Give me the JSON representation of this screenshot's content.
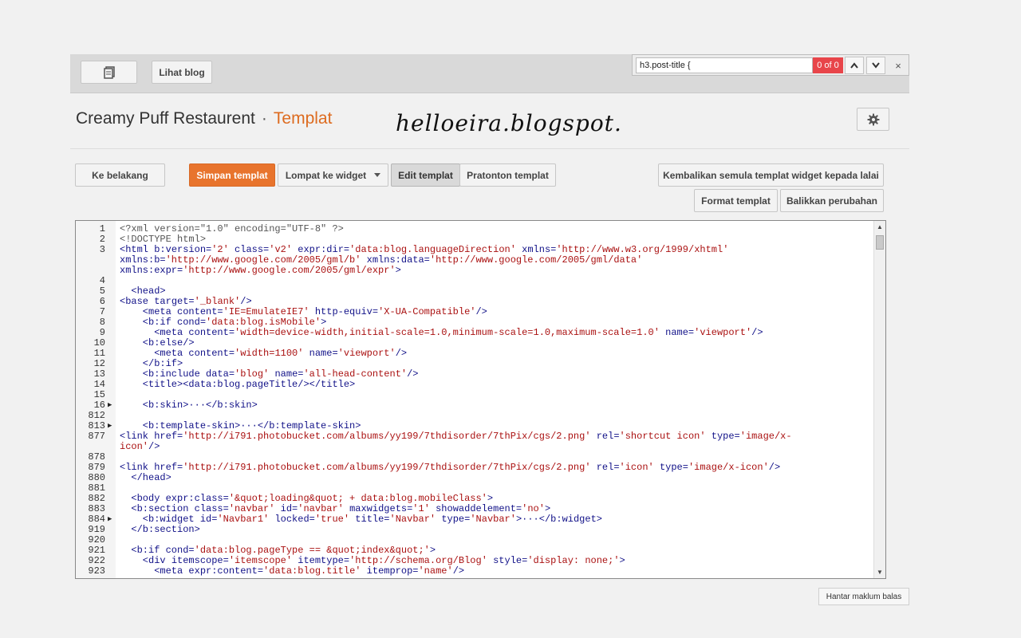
{
  "topbar": {
    "lihat_blog_label": "Lihat blog"
  },
  "find": {
    "value": "h3.post-title {",
    "count": "0 of 0",
    "close": "×"
  },
  "header": {
    "blog_name": "Creamy Puff Restaurent",
    "separator": "·",
    "section": "Templat",
    "watermark": "helloeira.blogspot."
  },
  "toolbar": {
    "ke_belakang": "Ke belakang",
    "simpan": "Simpan templat",
    "lompat": "Lompat ke widget",
    "edit": "Edit templat",
    "pratonton": "Pratonton templat",
    "kembalikan": "Kembalikan semula templat widget kepada lalai",
    "format": "Format templat",
    "balikkan": "Balikkan perubahan"
  },
  "editor": {
    "lines": [
      {
        "n": "1",
        "f": "",
        "c": [
          [
            "p",
            "<?xml version=\"1.0\" encoding=\"UTF-8\" ?>"
          ]
        ]
      },
      {
        "n": "2",
        "f": "",
        "c": [
          [
            "p",
            "<!DOCTYPE html>"
          ]
        ]
      },
      {
        "n": "3",
        "f": "",
        "c": [
          [
            "t",
            "<html "
          ],
          [
            "a",
            "b:version="
          ],
          [
            "v",
            "'2' "
          ],
          [
            "a",
            "class="
          ],
          [
            "v",
            "'v2' "
          ],
          [
            "a",
            "expr:dir="
          ],
          [
            "v",
            "'data:blog.languageDirection' "
          ],
          [
            "a",
            "xmlns="
          ],
          [
            "v",
            "'http://www.w3.org/1999/xhtml'"
          ]
        ]
      },
      {
        "n": "",
        "f": "",
        "c": [
          [
            "a",
            "xmlns:b="
          ],
          [
            "v",
            "'http://www.google.com/2005/gml/b' "
          ],
          [
            "a",
            "xmlns:data="
          ],
          [
            "v",
            "'http://www.google.com/2005/gml/data'"
          ]
        ]
      },
      {
        "n": "",
        "f": "",
        "c": [
          [
            "a",
            "xmlns:expr="
          ],
          [
            "v",
            "'http://www.google.com/2005/gml/expr'"
          ],
          [
            "t",
            ">"
          ]
        ]
      },
      {
        "n": "4",
        "f": "",
        "c": [
          [
            "p",
            ""
          ]
        ]
      },
      {
        "n": "5",
        "f": "",
        "c": [
          [
            "t",
            "  <head>"
          ]
        ]
      },
      {
        "n": "6",
        "f": "",
        "c": [
          [
            "t",
            "<base "
          ],
          [
            "a",
            "target="
          ],
          [
            "v",
            "'_blank'"
          ],
          [
            "t",
            "/>"
          ]
        ]
      },
      {
        "n": "7",
        "f": "",
        "c": [
          [
            "t",
            "    <meta "
          ],
          [
            "a",
            "content="
          ],
          [
            "v",
            "'IE=EmulateIE7' "
          ],
          [
            "a",
            "http-equiv="
          ],
          [
            "v",
            "'X-UA-Compatible'"
          ],
          [
            "t",
            "/>"
          ]
        ]
      },
      {
        "n": "8",
        "f": "",
        "c": [
          [
            "t",
            "    <b:if "
          ],
          [
            "a",
            "cond="
          ],
          [
            "v",
            "'data:blog.isMobile'"
          ],
          [
            "t",
            ">"
          ]
        ]
      },
      {
        "n": "9",
        "f": "",
        "c": [
          [
            "t",
            "      <meta "
          ],
          [
            "a",
            "content="
          ],
          [
            "v",
            "'width=device-width,initial-scale=1.0,minimum-scale=1.0,maximum-scale=1.0' "
          ],
          [
            "a",
            "name="
          ],
          [
            "v",
            "'viewport'"
          ],
          [
            "t",
            "/>"
          ]
        ]
      },
      {
        "n": "10",
        "f": "",
        "c": [
          [
            "t",
            "    <b:else/>"
          ]
        ]
      },
      {
        "n": "11",
        "f": "",
        "c": [
          [
            "t",
            "      <meta "
          ],
          [
            "a",
            "content="
          ],
          [
            "v",
            "'width=1100' "
          ],
          [
            "a",
            "name="
          ],
          [
            "v",
            "'viewport'"
          ],
          [
            "t",
            "/>"
          ]
        ]
      },
      {
        "n": "12",
        "f": "",
        "c": [
          [
            "t",
            "    </b:if>"
          ]
        ]
      },
      {
        "n": "13",
        "f": "",
        "c": [
          [
            "t",
            "    <b:include "
          ],
          [
            "a",
            "data="
          ],
          [
            "v",
            "'blog' "
          ],
          [
            "a",
            "name="
          ],
          [
            "v",
            "'all-head-content'"
          ],
          [
            "t",
            "/>"
          ]
        ]
      },
      {
        "n": "14",
        "f": "",
        "c": [
          [
            "t",
            "    <title><data:blog.pageTitle/></title>"
          ]
        ]
      },
      {
        "n": "15",
        "f": "",
        "c": [
          [
            "p",
            ""
          ]
        ]
      },
      {
        "n": "16",
        "f": "▶",
        "c": [
          [
            "t",
            "    <b:skin>···</b:skin>"
          ]
        ]
      },
      {
        "n": "812",
        "f": "",
        "c": [
          [
            "p",
            ""
          ]
        ]
      },
      {
        "n": "813",
        "f": "▶",
        "c": [
          [
            "t",
            "    <b:template-skin>···</b:template-skin>"
          ]
        ]
      },
      {
        "n": "877",
        "f": "",
        "c": [
          [
            "t",
            "<link "
          ],
          [
            "a",
            "href="
          ],
          [
            "v",
            "'http://i791.photobucket.com/albums/yy199/7thdisorder/7thPix/cgs/2.png' "
          ],
          [
            "a",
            "rel="
          ],
          [
            "v",
            "'shortcut icon' "
          ],
          [
            "a",
            "type="
          ],
          [
            "v",
            "'image/x-"
          ]
        ]
      },
      {
        "n": "",
        "f": "",
        "c": [
          [
            "v",
            "icon'"
          ],
          [
            "t",
            "/>"
          ]
        ]
      },
      {
        "n": "878",
        "f": "",
        "c": [
          [
            "p",
            ""
          ]
        ]
      },
      {
        "n": "879",
        "f": "",
        "c": [
          [
            "t",
            "<link "
          ],
          [
            "a",
            "href="
          ],
          [
            "v",
            "'http://i791.photobucket.com/albums/yy199/7thdisorder/7thPix/cgs/2.png' "
          ],
          [
            "a",
            "rel="
          ],
          [
            "v",
            "'icon' "
          ],
          [
            "a",
            "type="
          ],
          [
            "v",
            "'image/x-icon'"
          ],
          [
            "t",
            "/>"
          ]
        ]
      },
      {
        "n": "880",
        "f": "",
        "c": [
          [
            "t",
            "  </head>"
          ]
        ]
      },
      {
        "n": "881",
        "f": "",
        "c": [
          [
            "p",
            ""
          ]
        ]
      },
      {
        "n": "882",
        "f": "",
        "c": [
          [
            "t",
            "  <body "
          ],
          [
            "a",
            "expr:class="
          ],
          [
            "v",
            "'&quot;loading&quot; + data:blog.mobileClass'"
          ],
          [
            "t",
            ">"
          ]
        ]
      },
      {
        "n": "883",
        "f": "",
        "c": [
          [
            "t",
            "  <b:section "
          ],
          [
            "a",
            "class="
          ],
          [
            "v",
            "'navbar' "
          ],
          [
            "a",
            "id="
          ],
          [
            "v",
            "'navbar' "
          ],
          [
            "a",
            "maxwidgets="
          ],
          [
            "v",
            "'1' "
          ],
          [
            "a",
            "showaddelement="
          ],
          [
            "v",
            "'no'"
          ],
          [
            "t",
            ">"
          ]
        ]
      },
      {
        "n": "884",
        "f": "▶",
        "c": [
          [
            "t",
            "    <b:widget "
          ],
          [
            "a",
            "id="
          ],
          [
            "v",
            "'Navbar1' "
          ],
          [
            "a",
            "locked="
          ],
          [
            "v",
            "'true' "
          ],
          [
            "a",
            "title="
          ],
          [
            "v",
            "'Navbar' "
          ],
          [
            "a",
            "type="
          ],
          [
            "v",
            "'Navbar'"
          ],
          [
            "t",
            ">···</b:widget>"
          ]
        ]
      },
      {
        "n": "919",
        "f": "",
        "c": [
          [
            "t",
            "  </b:section>"
          ]
        ]
      },
      {
        "n": "920",
        "f": "",
        "c": [
          [
            "p",
            ""
          ]
        ]
      },
      {
        "n": "921",
        "f": "",
        "c": [
          [
            "t",
            "  <b:if "
          ],
          [
            "a",
            "cond="
          ],
          [
            "v",
            "'data:blog.pageType == &quot;index&quot;'"
          ],
          [
            "t",
            ">"
          ]
        ]
      },
      {
        "n": "922",
        "f": "",
        "c": [
          [
            "t",
            "    <div "
          ],
          [
            "a",
            "itemscope="
          ],
          [
            "v",
            "'itemscope' "
          ],
          [
            "a",
            "itemtype="
          ],
          [
            "v",
            "'http://schema.org/Blog' "
          ],
          [
            "a",
            "style="
          ],
          [
            "v",
            "'display: none;'"
          ],
          [
            "t",
            ">"
          ]
        ]
      },
      {
        "n": "923",
        "f": "",
        "c": [
          [
            "t",
            "      <meta "
          ],
          [
            "a",
            "expr:content="
          ],
          [
            "v",
            "'data:blog.title' "
          ],
          [
            "a",
            "itemprop="
          ],
          [
            "v",
            "'name'"
          ],
          [
            "t",
            "/>"
          ]
        ]
      }
    ]
  },
  "footer": {
    "feedback": "Hantar maklum balas"
  }
}
